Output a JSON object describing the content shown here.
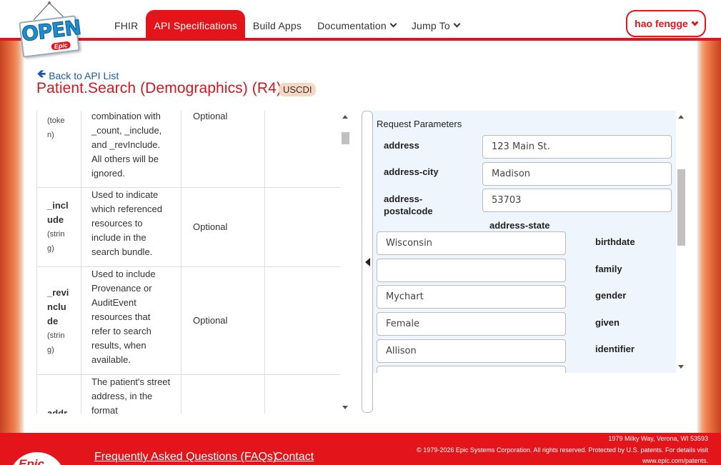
{
  "logo": {
    "main": "OPEN",
    "sub": "Epic"
  },
  "nav": {
    "items": [
      {
        "label": "FHIR"
      },
      {
        "label": "API Specifications"
      },
      {
        "label": "Build Apps"
      },
      {
        "label": "Documentation"
      },
      {
        "label": "Jump To"
      }
    ]
  },
  "user": {
    "name": "hao fengge"
  },
  "header": {
    "back_label": "Back to API List",
    "title": "Patient.Search (Demographics) (R4)",
    "badge": "USCDI"
  },
  "params_table": {
    "rows": [
      {
        "name": "",
        "type": "(token)",
        "description": "combination with _count, _include, and _revInclude. All others will be ignored.",
        "required": "Optional"
      },
      {
        "name": "_include",
        "type": "(string)",
        "description": "Used to indicate which referenced resources to include in the search bundle.",
        "required": "Optional"
      },
      {
        "name": "_revinclude",
        "type": "(string)",
        "description": "Used to include Provenance or AuditEvent resources that refer to search results, when available.",
        "required": "Optional"
      },
      {
        "name": "address",
        "type": "",
        "description": "The patient's street address, in the format",
        "required": ""
      }
    ]
  },
  "request_params": {
    "title": "Request Parameters",
    "fields": [
      {
        "label": "address",
        "value": "123 Main St."
      },
      {
        "label": "address-city",
        "value": "Madison"
      },
      {
        "label": "address-postalcode",
        "value": "53703"
      },
      {
        "label": "address-state",
        "value": "Wisconsin"
      },
      {
        "label": "birthdate",
        "value": ""
      },
      {
        "label": "family",
        "value": "Mychart"
      },
      {
        "label": "gender",
        "value": "Female"
      },
      {
        "label": "given",
        "value": "Allison"
      },
      {
        "label": "identifier",
        "value": ""
      }
    ]
  },
  "footer": {
    "logo_text": "Epic",
    "faq_label": "Frequently Asked Questions (FAQs)",
    "contact_label": "Contact",
    "address": "1979 Milky Way, Verona, WI 53593",
    "copyright": "© 1979-2026 Epic Systems Corporation. All rights reserved. Protected by U.S. patents. For details visit",
    "patents_url": "www.epic.com/patents."
  },
  "colors": {
    "brand_red": "#e4141b",
    "link_blue": "#1a5aa6",
    "badge_bg": "#f8d6c2",
    "form_bg": "#eef5fc"
  }
}
